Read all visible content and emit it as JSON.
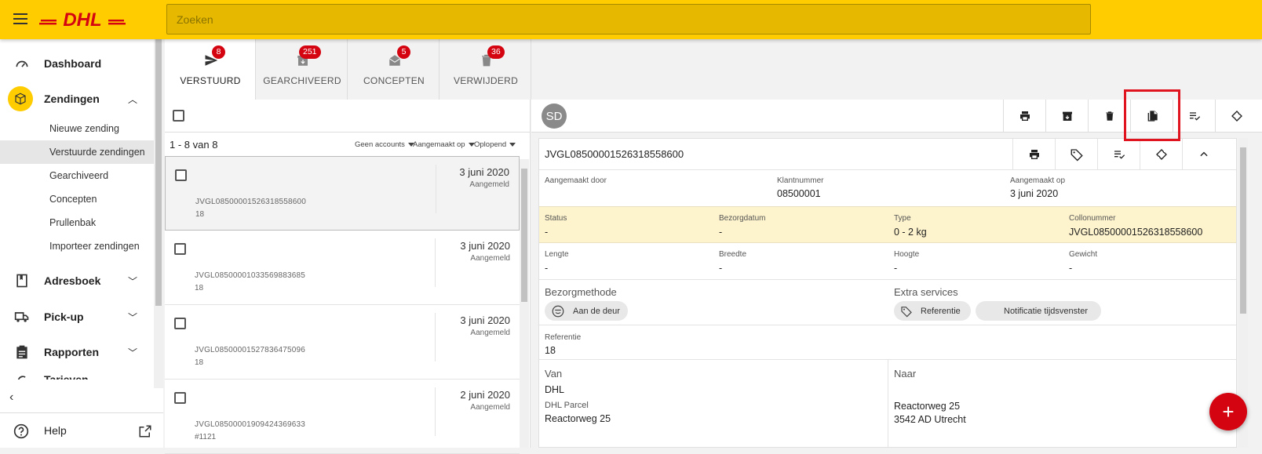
{
  "header": {
    "search_placeholder": "Zoeken",
    "logo": "DHL"
  },
  "sidebar": {
    "items": [
      {
        "label": "Dashboard",
        "icon": "speedometer-icon"
      },
      {
        "label": "Zendingen",
        "icon": "package-icon",
        "expanded": true
      },
      {
        "label": "Adresboek",
        "icon": "book-icon"
      },
      {
        "label": "Pick-up",
        "icon": "truck-icon"
      },
      {
        "label": "Rapporten",
        "icon": "clipboard-icon"
      },
      {
        "label": "Tarieven",
        "icon": "euro-icon"
      }
    ],
    "sub_items": [
      "Nieuwe zending",
      "Verstuurde zendingen",
      "Gearchiveerd",
      "Concepten",
      "Prullenbak",
      "Importeer zendingen"
    ],
    "active_sub": "Verstuurde zendingen",
    "help_label": "Help"
  },
  "tabs": [
    {
      "label": "VERSTUURD",
      "badge": "8",
      "icon": "send-icon",
      "active": true
    },
    {
      "label": "GEARCHIVEERD",
      "badge": "251",
      "icon": "archive-icon"
    },
    {
      "label": "CONCEPTEN",
      "badge": "5",
      "icon": "draft-icon"
    },
    {
      "label": "VERWIJDERD",
      "badge": "36",
      "icon": "trash-icon"
    }
  ],
  "list": {
    "count_text": "1 - 8 van 8",
    "filters": [
      "Geen accounts",
      "Aangemaakt op",
      "Oplopend"
    ],
    "rows": [
      {
        "id": "JVGL08500001526318558600",
        "ref": "18",
        "date": "3 juni 2020",
        "status": "Aangemeld"
      },
      {
        "id": "JVGL08500001033569883685",
        "ref": "18",
        "date": "3 juni 2020",
        "status": "Aangemeld"
      },
      {
        "id": "JVGL08500001527836475096",
        "ref": "18",
        "date": "3 juni 2020",
        "status": "Aangemeld"
      },
      {
        "id": "JVGL08500001909424369633",
        "ref": "#1121",
        "date": "2 juni 2020",
        "status": "Aangemeld"
      }
    ]
  },
  "detail": {
    "avatar_initials": "SD",
    "toolbar_icons": [
      "print-icon",
      "archive-icon",
      "trash-icon",
      "copy-icon",
      "playlist-check-icon",
      "ticket-icon"
    ],
    "shipment_id": "JVGL08500001526318558600",
    "card_icons": [
      "print-icon",
      "tag-icon",
      "playlist-check-icon",
      "ticket-icon",
      "chevron-up-icon"
    ],
    "meta": {
      "created_by_label": "Aangemaakt door",
      "created_by_value": "",
      "customer_label": "Klantnummer",
      "customer_value": "08500001",
      "created_on_label": "Aangemaakt op",
      "created_on_value": "3 juni 2020"
    },
    "status_row": {
      "status_label": "Status",
      "status_value": "-",
      "delivery_label": "Bezorgdatum",
      "delivery_value": "-",
      "type_label": "Type",
      "type_value": "0 - 2 kg",
      "collo_label": "Collonummer",
      "collo_value": "JVGL08500001526318558600"
    },
    "dims": {
      "length_label": "Lengte",
      "length_value": "-",
      "width_label": "Breedte",
      "width_value": "-",
      "height_label": "Hoogte",
      "height_value": "-",
      "weight_label": "Gewicht",
      "weight_value": "-"
    },
    "method_title": "Bezorgmethode",
    "method_chip": "Aan de deur",
    "extras_title": "Extra services",
    "extra_chips": [
      "Referentie",
      "Notificatie tijdsvenster"
    ],
    "reference_label": "Referentie",
    "reference_value": "18",
    "from": {
      "title": "Van",
      "name": "DHL",
      "company": "DHL Parcel",
      "street": "Reactorweg 25"
    },
    "to": {
      "title": "Naar",
      "street": "Reactorweg 25",
      "city": "3542 AD Utrecht"
    }
  },
  "colors": {
    "brand_yellow": "#ffcc00",
    "brand_red": "#d40511",
    "highlight_box": "#e0141e",
    "status_band": "#fdf3cc"
  }
}
